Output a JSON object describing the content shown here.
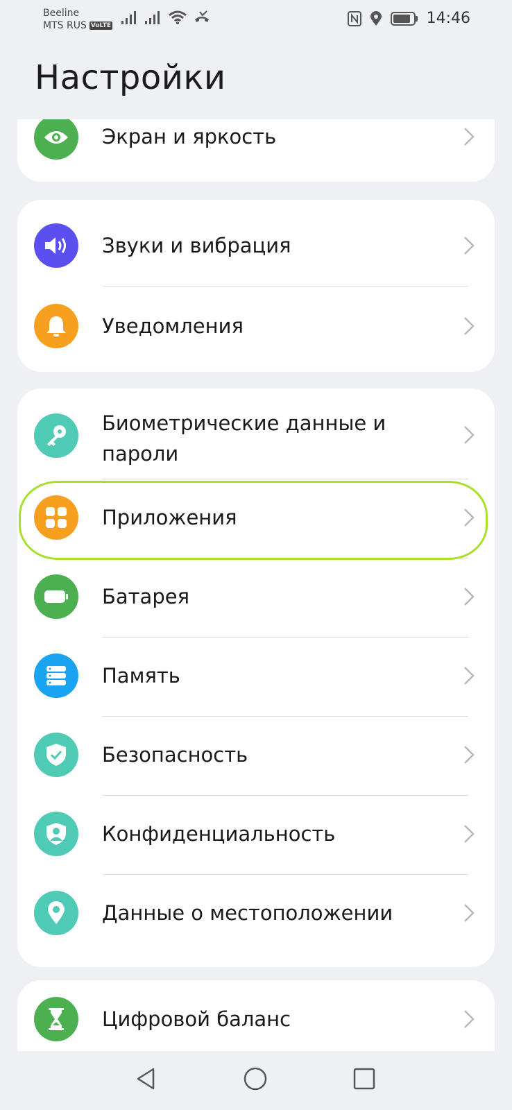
{
  "status_bar": {
    "carrier_1": "Beeline",
    "carrier_2": "MTS RUS",
    "volte_badge": "VoLTE",
    "time": "14:46",
    "icons": [
      "signal-icon",
      "signal-icon",
      "wifi-icon",
      "call-icon",
      "nfc-icon",
      "location-icon",
      "battery-icon"
    ]
  },
  "header": {
    "title": "Настройки"
  },
  "groups": [
    {
      "items": [
        {
          "label": "Экран и яркость",
          "icon": "eye-icon",
          "color": "#4caf50"
        }
      ]
    },
    {
      "items": [
        {
          "label": "Звуки и вибрация",
          "icon": "volume-icon",
          "color": "#5b4ff0"
        },
        {
          "label": "Уведомления",
          "icon": "bell-icon",
          "color": "#f7a020"
        }
      ]
    },
    {
      "items": [
        {
          "label": "Биометрические данные и пароли",
          "icon": "key-icon",
          "color": "#4fcbb5"
        },
        {
          "label": "Приложения",
          "icon": "apps-icon",
          "color": "#f7a020",
          "highlighted": true
        },
        {
          "label": "Батарея",
          "icon": "battery-icon",
          "color": "#4caf50"
        },
        {
          "label": "Память",
          "icon": "storage-icon",
          "color": "#1aa3f0"
        },
        {
          "label": "Безопасность",
          "icon": "shield-icon",
          "color": "#4fcbb5"
        },
        {
          "label": "Конфиденциальность",
          "icon": "privacy-icon",
          "color": "#4fcbb5"
        },
        {
          "label": "Данные о местоположении",
          "icon": "location-icon",
          "color": "#4fcbb5"
        }
      ]
    },
    {
      "items": [
        {
          "label": "Цифровой баланс",
          "icon": "hourglass-icon",
          "color": "#4caf50"
        }
      ]
    }
  ],
  "nav": {
    "buttons": [
      "back-icon",
      "home-icon",
      "recents-icon"
    ]
  },
  "colors": {
    "background": "#eff0f3",
    "card": "#ffffff",
    "highlight": "#a8e02c",
    "chevron": "#b8b8b8"
  }
}
